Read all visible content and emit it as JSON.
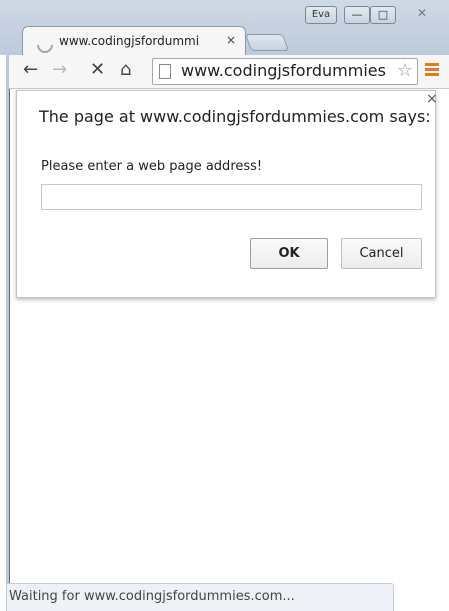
{
  "window": {
    "user_badge": "Eva",
    "minimize_glyph": "—",
    "maximize_glyph": "□",
    "close_glyph": "✕"
  },
  "tabs": [
    {
      "title": "www.codingjsfordummi",
      "close_glyph": "×",
      "loading": true
    }
  ],
  "toolbar": {
    "back_glyph": "←",
    "forward_glyph": "→",
    "stop_glyph": "✕",
    "home_glyph": "⌂",
    "url": "www.codingjsfordummies",
    "star_glyph": "☆",
    "icons": [
      "back-arrow-icon",
      "forward-arrow-icon",
      "stop-icon",
      "home-icon",
      "page-icon",
      "star-icon",
      "menu-icon"
    ],
    "menu_color": "#e07a1f"
  },
  "dialog": {
    "title": "The page at www.codingjsfordummies.com says:",
    "close_glyph": "×",
    "message": "Please enter a web page address!",
    "input_value": "",
    "ok_label": "OK",
    "cancel_label": "Cancel"
  },
  "status": {
    "text": "Waiting for www.codingjsfordummies.com..."
  }
}
